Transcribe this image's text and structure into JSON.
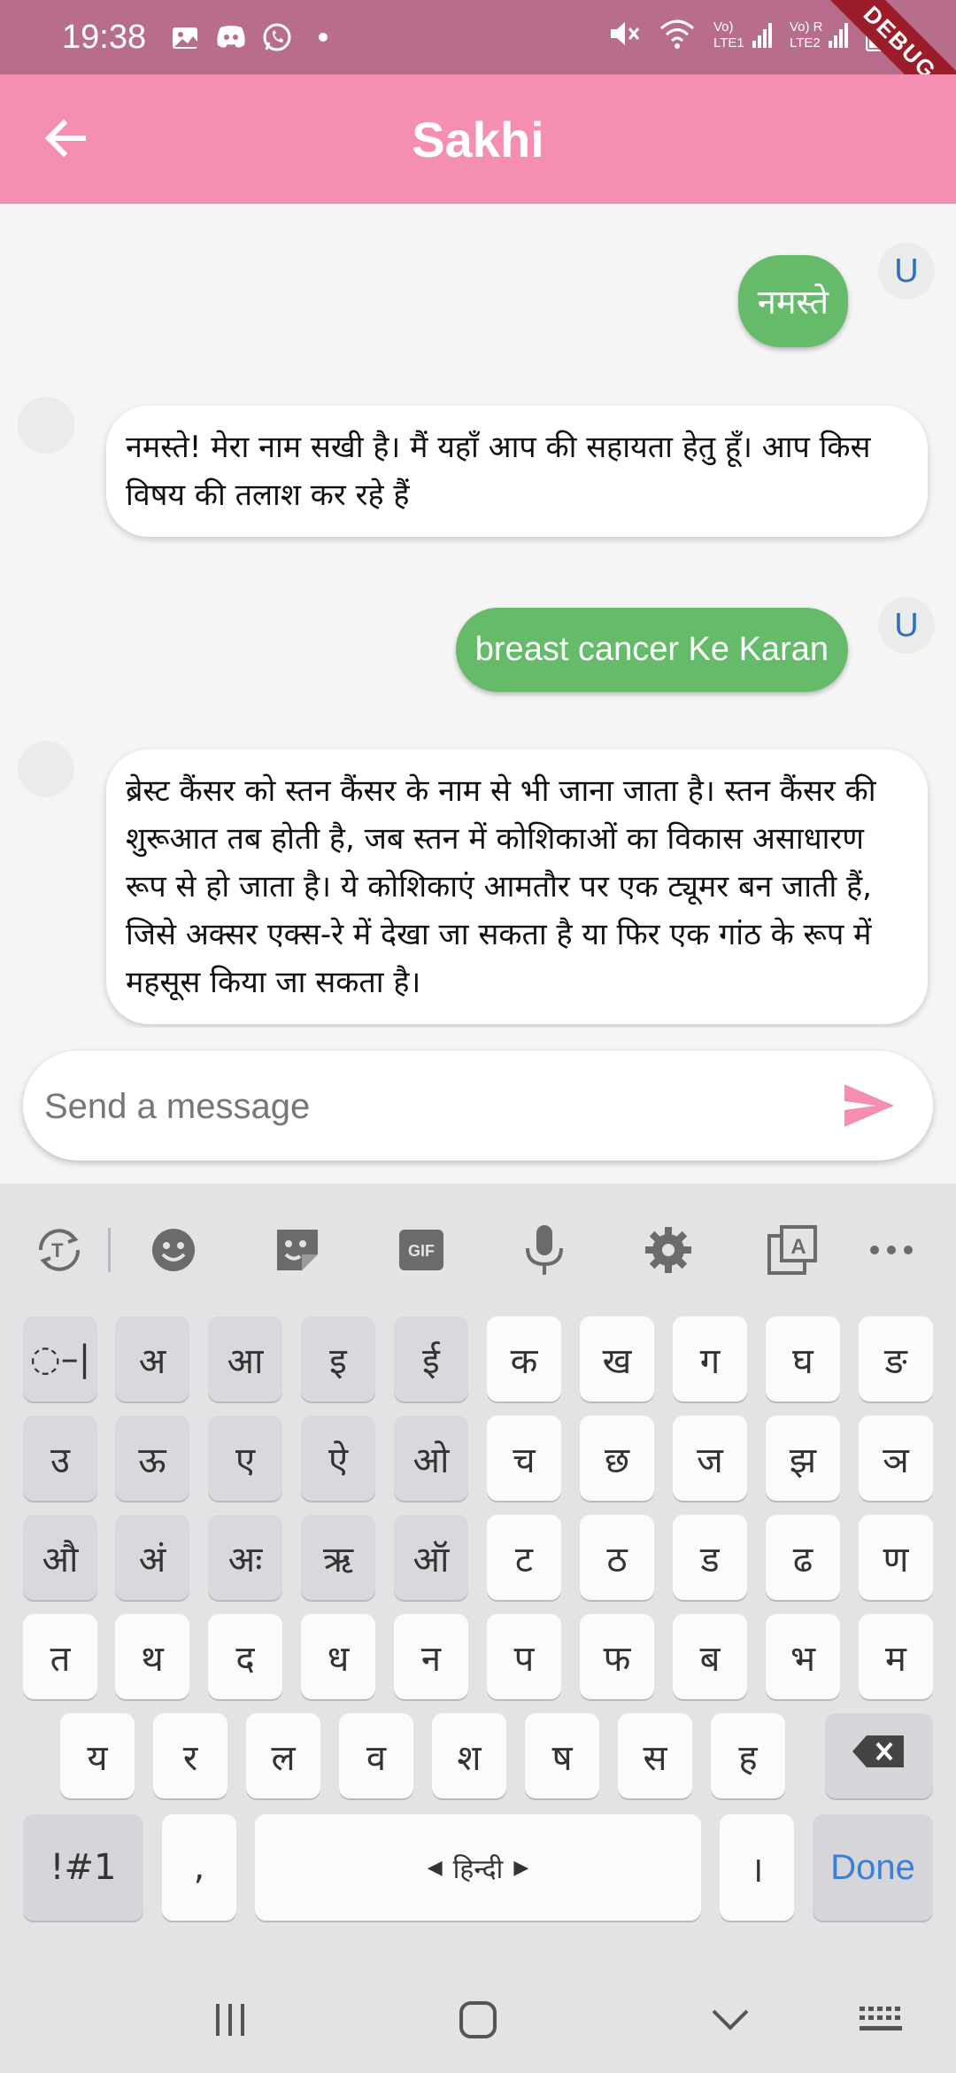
{
  "status_bar": {
    "time": "19:38",
    "banner": "DEBUG",
    "sim1": "Vo)\nLTE1",
    "sim2": "Vo) R\nLTE2"
  },
  "app_bar": {
    "title": "Sakhi"
  },
  "messages": [
    {
      "role": "user",
      "avatar": "U",
      "text": "नमस्ते"
    },
    {
      "role": "bot",
      "text": "नमस्ते!  मेरा नाम सखी है। मैं यहाँ आप की सहायता हेतु हूँ। आप किस विषय की तलाश कर रहे हैं"
    },
    {
      "role": "user",
      "avatar": "U",
      "text": "breast cancer Ke Karan"
    },
    {
      "role": "bot",
      "text": "ब्रेस्ट कैंसर को स्तन कैंसर के नाम से भी जाना जाता है। स्तन कैंसर की शुरूआत तब होती है, जब स्तन में कोशिकाओं का विकास असाधारण रूप से हो जाता है। ये कोशिकाएं आमतौर पर एक ट्यूमर बन जाती हैं, जिसे अक्सर एक्स-रे में देखा जा सकता है या फिर एक गांठ के रूप में महसूस किया जा सकता है।"
    }
  ],
  "composer": {
    "placeholder": "Send a message",
    "value": ""
  },
  "keyboard": {
    "toolbar_gif": "GIF",
    "row1": [
      "◌–|",
      "अ",
      "आ",
      "इ",
      "ई",
      "क",
      "ख",
      "ग",
      "घ",
      "ङ"
    ],
    "row2": [
      "उ",
      "ऊ",
      "ए",
      "ऐ",
      "ओ",
      "च",
      "छ",
      "ज",
      "झ",
      "ञ"
    ],
    "row3": [
      "औ",
      "अं",
      "अः",
      "ऋ",
      "ऑ",
      "ट",
      "ठ",
      "ड",
      "ढ",
      "ण"
    ],
    "row4": [
      "त",
      "थ",
      "द",
      "ध",
      "न",
      "प",
      "फ",
      "ब",
      "भ",
      "म"
    ],
    "row5": [
      "य",
      "र",
      "ल",
      "व",
      "श",
      "ष",
      "स",
      "ह"
    ],
    "symbols": "!#1",
    "comma": ",",
    "space": "हिन्दी",
    "danda": "।",
    "done": "Done"
  }
}
